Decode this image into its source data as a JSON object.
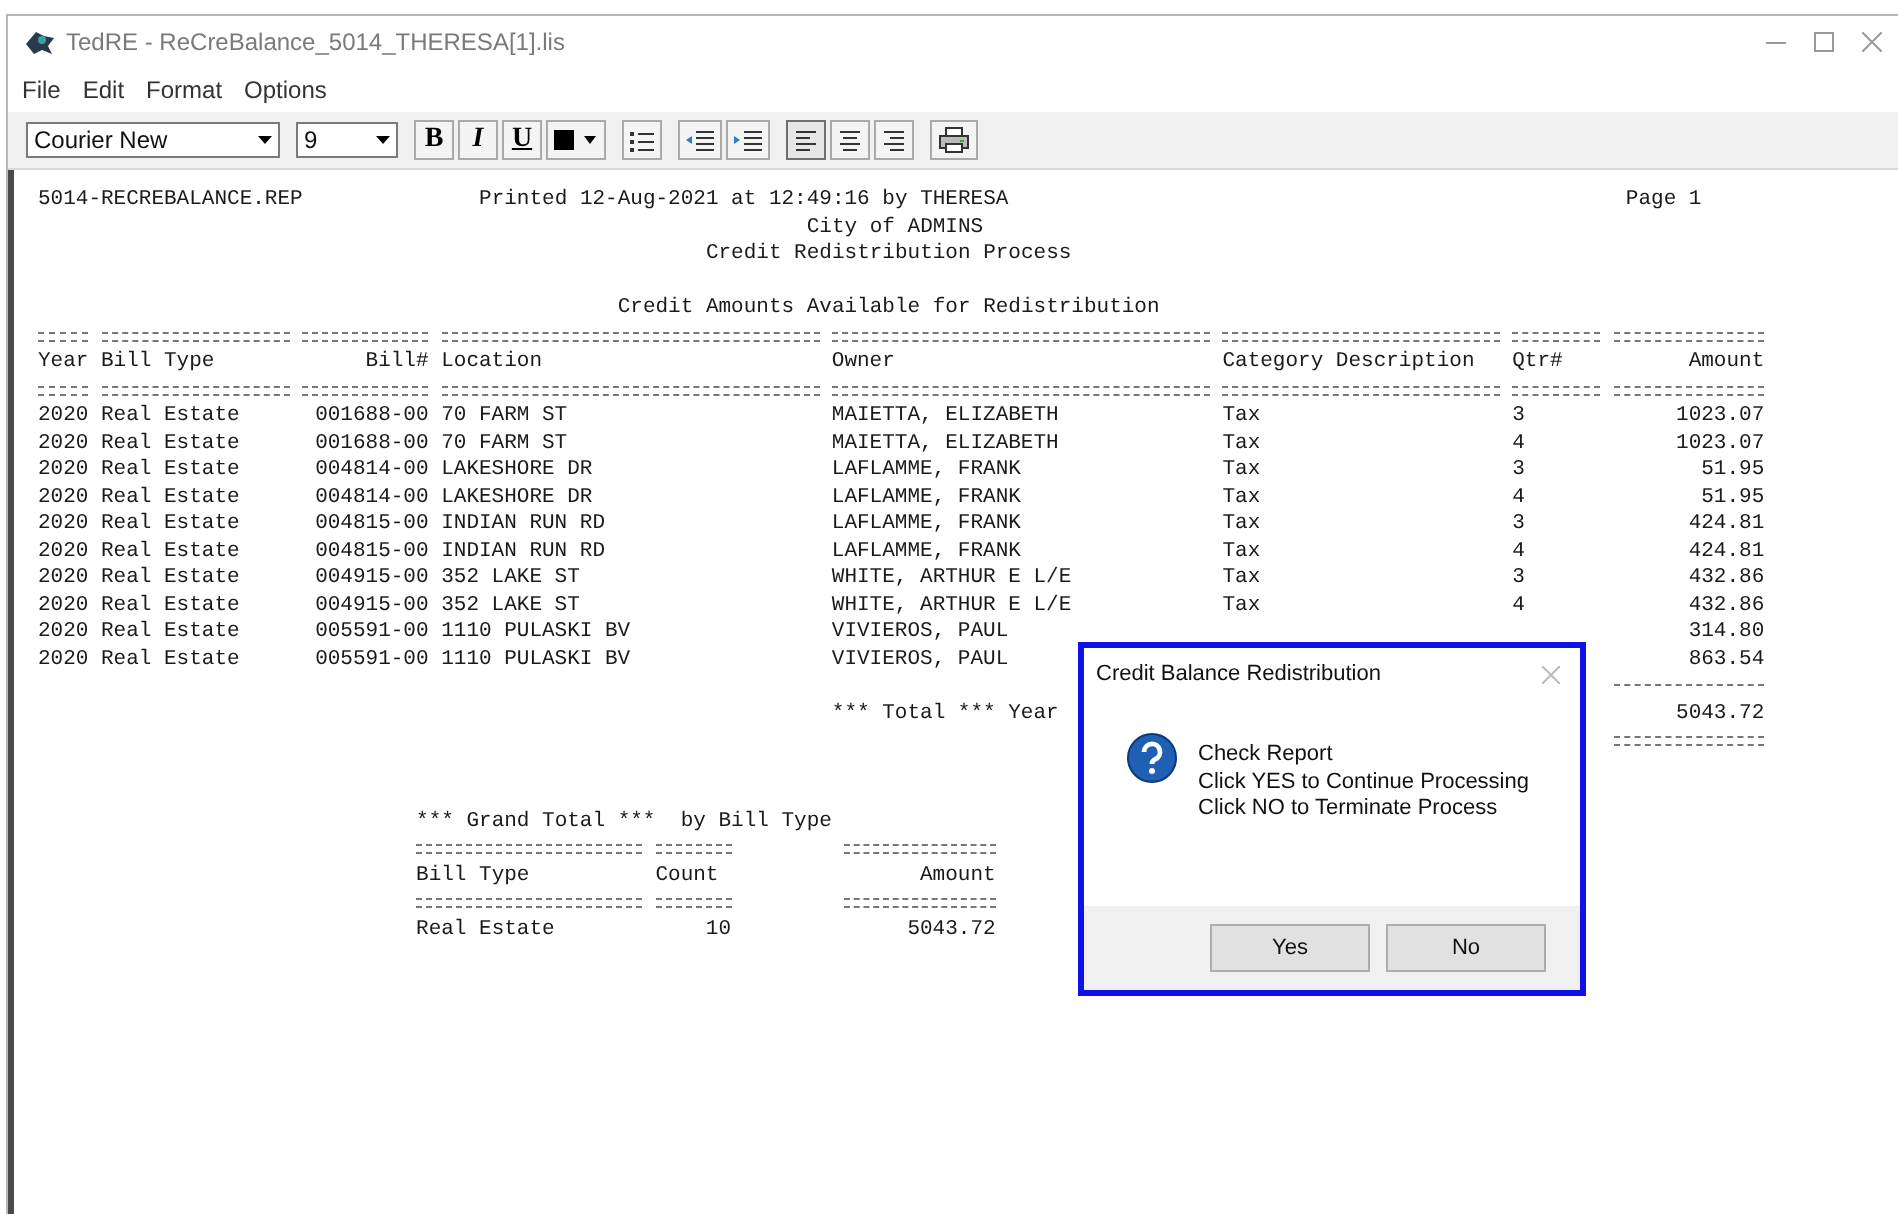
{
  "window": {
    "title": "TedRE - ReCreBalance_5014_THERESA[1].lis"
  },
  "menu": [
    "File",
    "Edit",
    "Format",
    "Options"
  ],
  "toolbar": {
    "font": "Courier New",
    "size": "9",
    "tools": [
      {
        "kind": "bold",
        "label": "B"
      },
      {
        "kind": "italic",
        "label": "I"
      },
      {
        "kind": "underline",
        "label": "U"
      },
      {
        "kind": "color"
      },
      {
        "kind": "bullets"
      },
      {
        "kind": "outdent"
      },
      {
        "kind": "indent"
      },
      {
        "kind": "align-left",
        "selected": true
      },
      {
        "kind": "align-center",
        "selected": false
      },
      {
        "kind": "align-right",
        "selected": false
      },
      {
        "kind": "print"
      }
    ]
  },
  "report": {
    "file": "5014-RECREBALANCE.REP",
    "printed": "Printed 12-Aug-2021 at 12:49:16 by THERESA",
    "page": "Page 1",
    "city": "City of ADMINS",
    "process": "Credit Redistribution Process",
    "section_title": "Credit Amounts Available for Redistribution",
    "table": {
      "columns": [
        "Year",
        "Bill Type",
        "Bill#",
        "Location",
        "Owner",
        "Category Description",
        "Qtr#",
        "Amount"
      ],
      "rows": [
        {
          "year": "2020",
          "bill_type": "Real Estate",
          "bill": "001688-00",
          "location": "70 FARM ST",
          "owner": "MAIETTA, ELIZABETH",
          "category": "Tax",
          "qtr": "3",
          "amount": "1023.07"
        },
        {
          "year": "2020",
          "bill_type": "Real Estate",
          "bill": "001688-00",
          "location": "70 FARM ST",
          "owner": "MAIETTA, ELIZABETH",
          "category": "Tax",
          "qtr": "4",
          "amount": "1023.07"
        },
        {
          "year": "2020",
          "bill_type": "Real Estate",
          "bill": "004814-00",
          "location": "LAKESHORE DR",
          "owner": "LAFLAMME, FRANK",
          "category": "Tax",
          "qtr": "3",
          "amount": "51.95"
        },
        {
          "year": "2020",
          "bill_type": "Real Estate",
          "bill": "004814-00",
          "location": "LAKESHORE DR",
          "owner": "LAFLAMME, FRANK",
          "category": "Tax",
          "qtr": "4",
          "amount": "51.95"
        },
        {
          "year": "2020",
          "bill_type": "Real Estate",
          "bill": "004815-00",
          "location": "INDIAN RUN RD",
          "owner": "LAFLAMME, FRANK",
          "category": "Tax",
          "qtr": "3",
          "amount": "424.81"
        },
        {
          "year": "2020",
          "bill_type": "Real Estate",
          "bill": "004815-00",
          "location": "INDIAN RUN RD",
          "owner": "LAFLAMME, FRANK",
          "category": "Tax",
          "qtr": "4",
          "amount": "424.81"
        },
        {
          "year": "2020",
          "bill_type": "Real Estate",
          "bill": "004915-00",
          "location": "352 LAKE ST",
          "owner": "WHITE, ARTHUR E L/E",
          "category": "Tax",
          "qtr": "3",
          "amount": "432.86"
        },
        {
          "year": "2020",
          "bill_type": "Real Estate",
          "bill": "004915-00",
          "location": "352 LAKE ST",
          "owner": "WHITE, ARTHUR E L/E",
          "category": "Tax",
          "qtr": "4",
          "amount": "432.86"
        },
        {
          "year": "2020",
          "bill_type": "Real Estate",
          "bill": "005591-00",
          "location": "1110 PULASKI BV",
          "owner": "VIVIEROS, PAUL",
          "amount": "314.80"
        },
        {
          "year": "2020",
          "bill_type": "Real Estate",
          "bill": "005591-00",
          "location": "1110 PULASKI BV",
          "owner": "VIVIEROS, PAUL",
          "amount": "863.54"
        }
      ],
      "total_label": "*** Total *** Year",
      "total_amount": "5043.72"
    },
    "grand_total": {
      "title": "*** Grand Total ***  by Bill Type",
      "columns": [
        "Bill Type",
        "Count",
        "Amount"
      ],
      "rows": [
        {
          "bill_type": "Real Estate",
          "count": "10",
          "amount": "5043.72"
        }
      ]
    }
  },
  "dialog": {
    "title": "Credit Balance Redistribution",
    "message_lines": [
      "Check Report",
      "Click YES to Continue Processing",
      "Click NO to Terminate Process"
    ],
    "buttons": [
      "Yes",
      "No"
    ]
  }
}
